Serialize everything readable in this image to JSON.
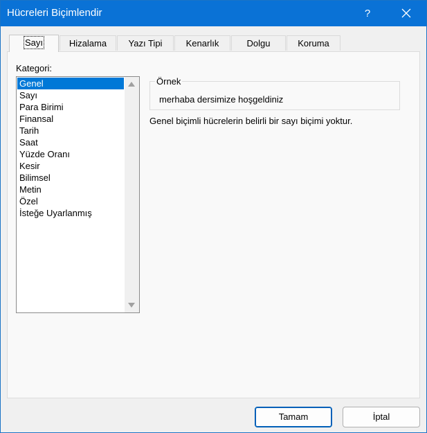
{
  "window": {
    "title": "Hücreleri Biçimlendir",
    "help_label": "?"
  },
  "tabs": [
    {
      "label": "Sayı",
      "active": true
    },
    {
      "label": "Hizalama"
    },
    {
      "label": "Yazı Tipi"
    },
    {
      "label": "Kenarlık"
    },
    {
      "label": "Dolgu"
    },
    {
      "label": "Koruma"
    }
  ],
  "category": {
    "label": "Kategori:",
    "items": [
      "Genel",
      "Sayı",
      "Para Birimi",
      "Finansal",
      "Tarih",
      "Saat",
      "Yüzde Oranı",
      "Kesir",
      "Bilimsel",
      "Metin",
      "Özel",
      "İsteğe Uyarlanmış"
    ],
    "selected": "Genel"
  },
  "sample": {
    "label": "Örnek",
    "value": "merhaba dersimize hoşgeldiniz"
  },
  "description": "Genel biçimli hücrelerin belirli bir sayı biçimi yoktur.",
  "buttons": {
    "ok": "Tamam",
    "cancel": "İptal"
  },
  "colors": {
    "titlebar": "#0a72d6",
    "selection": "#0078d7"
  }
}
